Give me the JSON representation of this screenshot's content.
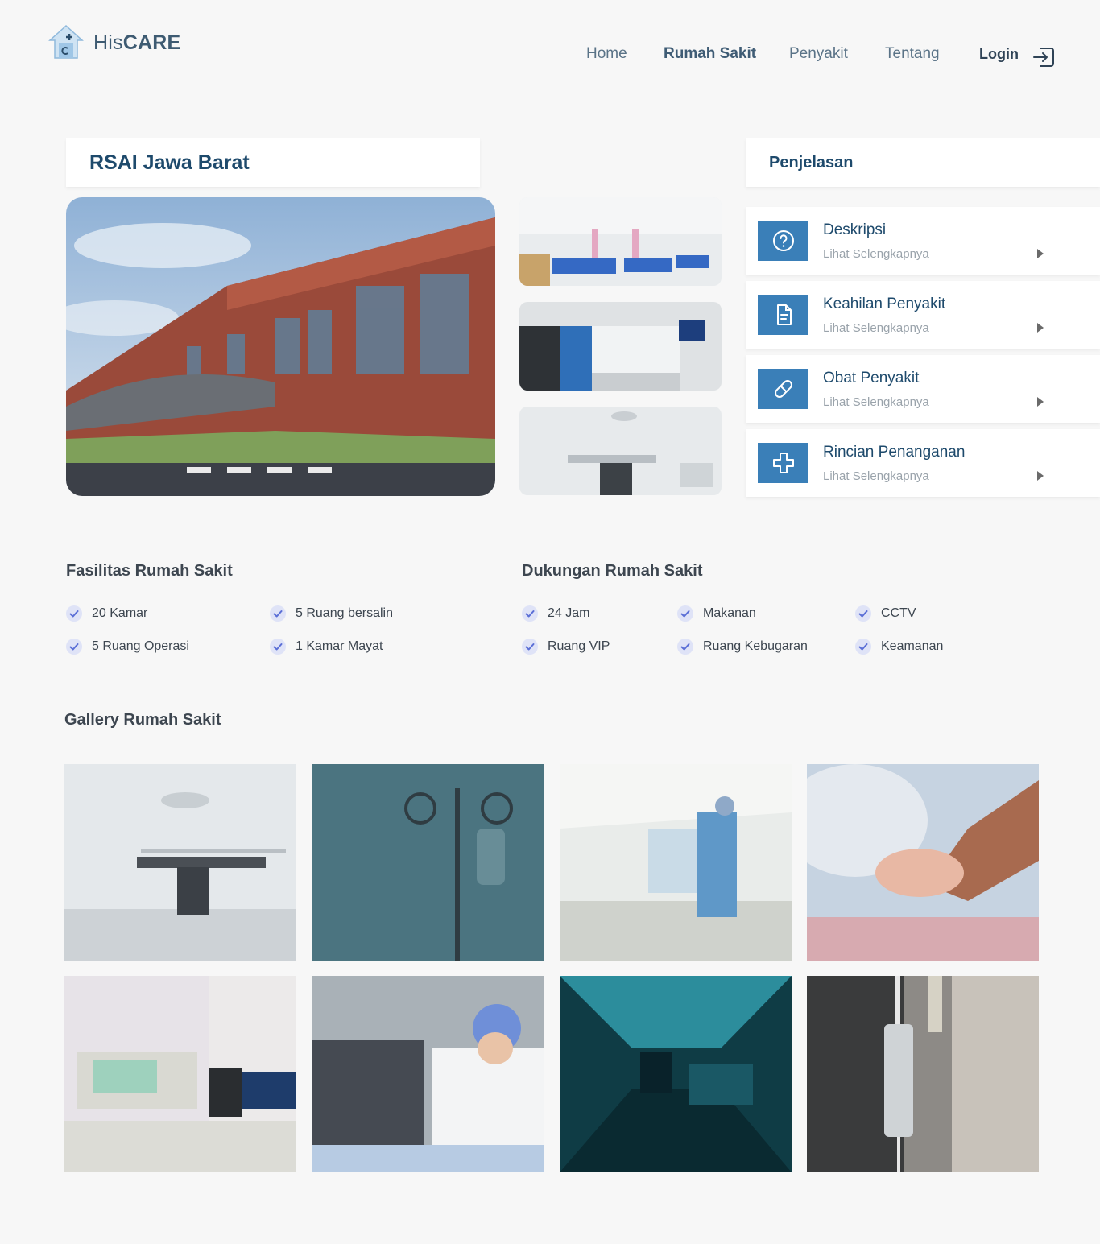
{
  "brand": {
    "prefix": "His",
    "bold": "CARE"
  },
  "nav": {
    "items": [
      {
        "label": "Home"
      },
      {
        "label": "Rumah Sakit"
      },
      {
        "label": "Penyakit"
      },
      {
        "label": "Tentang"
      }
    ],
    "login": "Login"
  },
  "hospital": {
    "name": "RSAI Jawa Barat"
  },
  "penjelasan": {
    "title": "Penjelasan",
    "items": [
      {
        "title": "Deskripsi",
        "sub": "Lihat Selengkapnya",
        "icon": "question-icon"
      },
      {
        "title": "Keahilan Penyakit",
        "sub": "Lihat Selengkapnya",
        "icon": "document-icon"
      },
      {
        "title": "Obat Penyakit",
        "sub": "Lihat Selengkapnya",
        "icon": "pill-icon"
      },
      {
        "title": "Rincian Penanganan",
        "sub": "Lihat Selengkapnya",
        "icon": "plus-icon"
      }
    ]
  },
  "fasilitas": {
    "title": "Fasilitas Rumah Sakit",
    "items": [
      "20 Kamar",
      "5 Ruang bersalin",
      "5 Ruang Operasi",
      "1 Kamar Mayat"
    ]
  },
  "dukungan": {
    "title": "Dukungan Rumah Sakit",
    "items": [
      "24 Jam",
      "Makanan",
      "CCTV",
      "Ruang VIP",
      "Ruang Kebugaran",
      "Keamanan"
    ]
  },
  "gallery": {
    "title": "Gallery Rumah Sakit"
  },
  "colors": {
    "accent": "#3a7fb8",
    "heading": "#1e4a6c",
    "check": "#5b6fd6"
  }
}
